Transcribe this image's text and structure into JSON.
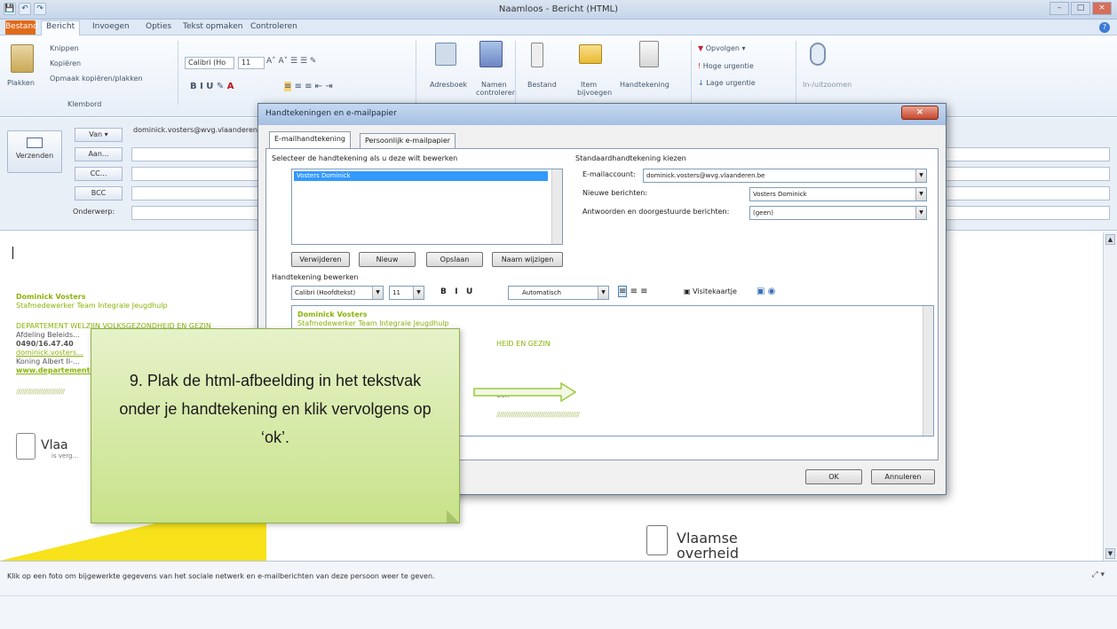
{
  "window": {
    "title": "Naamloos - Bericht (HTML)"
  },
  "qat": [
    "💾",
    "↶",
    "↷"
  ],
  "tabs": [
    "Bestand",
    "Bericht",
    "Invoegen",
    "Opties",
    "Tekst opmaken",
    "Controleren"
  ],
  "ribbon": {
    "paste": "Plakken",
    "cut": "Knippen",
    "copy": "Kopiëren",
    "format_painter": "Opmaak kopiëren/plakken",
    "clipboard_group": "Klembord",
    "font_name": "Calibri (Ho",
    "font_size": "11",
    "addressbook": "Adresboek",
    "check_names_1": "Namen",
    "check_names_2": "controleren",
    "attach_file": "Bestand",
    "attach_item_1": "Item",
    "attach_item_2": "bijvoegen",
    "signature": "Handtekening",
    "follow_up": "Opvolgen",
    "high_importance": "Hoge urgentie",
    "low_importance": "Lage urgentie",
    "zoom": "In-/uitzoomen"
  },
  "header": {
    "send": "Verzenden",
    "van": "Van",
    "van_value": "dominick.vosters@wvg.vlaanderen.be",
    "aan": "Aan...",
    "cc": "CC...",
    "bcc": "BCC",
    "subject": "Onderwerp:"
  },
  "signature_preview": {
    "name": "Dominick Vosters",
    "role": "Stafmedewerker Team Integrale Jeugdhulp",
    "dept": "DEPARTEMENT WELZIJN VOLKSGEZONDHEID EN GEZIN",
    "afd": "Afdeling Beleids...",
    "phone": "0490/16.47.40",
    "email": "dominick.vosters...",
    "addr": "Koning Albert II-...",
    "web": "www.departement...",
    "logo_1": "Vlaa",
    "logo_2": "is verg...",
    "bottom_logo_1": "Vlaamse",
    "bottom_logo_2": "overheid"
  },
  "people_pane": {
    "text": "Klik op een foto om bijgewerkte gegevens van het sociale netwerk en e-mailberichten van deze persoon weer te geven."
  },
  "dialog": {
    "title": "Handtekeningen en e-mailpapier",
    "tab_signature": "E-mailhandtekening",
    "tab_stationery": "Persoonlijk e-mailpapier",
    "select_label": "Selecteer de handtekening als u deze wilt bewerken",
    "list_items": [
      "Vosters Dominick"
    ],
    "btn_delete": "Verwijderen",
    "btn_new": "Nieuw",
    "btn_save": "Opslaan",
    "btn_rename": "Naam wijzigen",
    "default_label": "Standaardhandtekening kiezen",
    "account_label": "E-mailaccount:",
    "account_value": "dominick.vosters@wvg.vlaanderen.be",
    "new_msgs_label": "Nieuwe berichten:",
    "new_msgs_value": "Vosters Dominick",
    "replies_label": "Antwoorden en doorgestuurde berichten:",
    "replies_value": "(geen)",
    "edit_label": "Handtekening bewerken",
    "edit_font": "Calibri (Hoofdtekst)",
    "edit_size": "11",
    "edit_color": "Automatisch",
    "business_card": "Visitekaartje",
    "editor_name": "Dominick Vosters",
    "editor_role": "Stafmedewerker Team Integrale Jeugdhulp",
    "editor_dept": "HEID EN GEZIN",
    "editor_extra": "oon",
    "ok": "OK",
    "cancel": "Annuleren"
  },
  "callout": {
    "text": "9. Plak de html-afbeelding in het tekstvak onder je handtekening en klik vervolgens op ‘ok’."
  },
  "colors": {
    "callout_bg": "#d4e9a3",
    "arrow": "#9acb3c",
    "sig_green": "#8ab30a",
    "file_tab": "#e06a1a"
  }
}
